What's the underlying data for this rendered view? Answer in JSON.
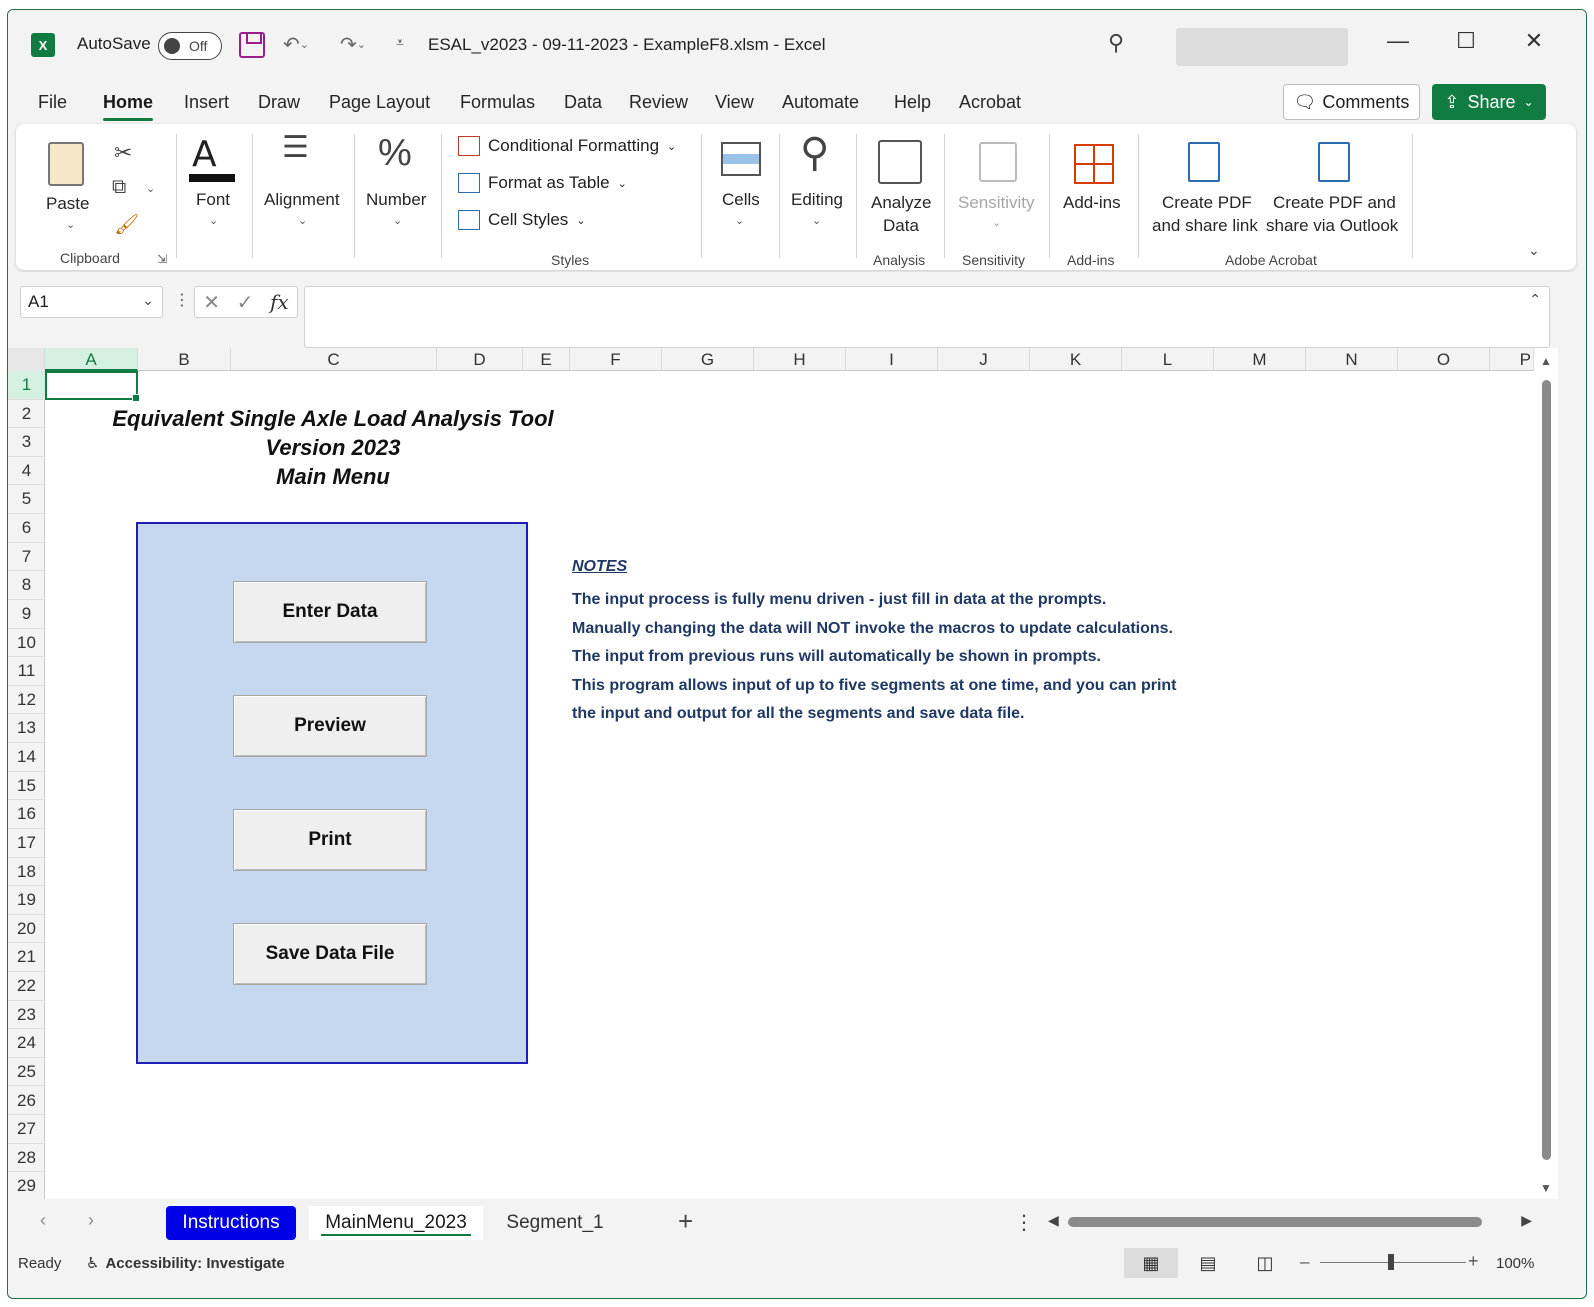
{
  "titlebar": {
    "app_icon": "excel-icon",
    "autosave_label": "AutoSave",
    "autosave_state": "Off",
    "document_title": "ESAL_v2023 - 09-11-2023 - ExampleF8.xlsm  -  Excel"
  },
  "menu": {
    "tabs": [
      "File",
      "Home",
      "Insert",
      "Draw",
      "Page Layout",
      "Formulas",
      "Data",
      "Review",
      "View",
      "Automate",
      "Help",
      "Acrobat"
    ],
    "active": "Home",
    "comments_label": "Comments",
    "share_label": "Share"
  },
  "ribbon": {
    "clipboard": {
      "paste": "Paste",
      "group": "Clipboard"
    },
    "font": "Font",
    "alignment": "Alignment",
    "number": "Number",
    "styles": {
      "conditional": "Conditional Formatting",
      "format_table": "Format as Table",
      "cell_styles": "Cell Styles",
      "group": "Styles"
    },
    "cells": "Cells",
    "editing": "Editing",
    "analyze": {
      "label1": "Analyze",
      "label2": "Data",
      "group": "Analysis"
    },
    "sensitivity": {
      "label": "Sensitivity",
      "group": "Sensitivity"
    },
    "addins": {
      "label": "Add-ins",
      "group": "Add-ins"
    },
    "acrobat": {
      "pdf_link_1": "Create PDF",
      "pdf_link_2": "and share link",
      "pdf_outlook_1": "Create PDF and",
      "pdf_outlook_2": "share via Outlook",
      "group": "Adobe Acrobat"
    }
  },
  "formula_bar": {
    "name_box": "A1",
    "fx": "fx",
    "formula": ""
  },
  "grid": {
    "columns": [
      "A",
      "B",
      "C",
      "D",
      "E",
      "F",
      "G",
      "H",
      "I",
      "J",
      "K",
      "L",
      "M",
      "N",
      "O",
      "P"
    ],
    "rows": [
      "1",
      "2",
      "3",
      "4",
      "5",
      "6",
      "7",
      "8",
      "9",
      "10",
      "11",
      "12",
      "13",
      "14",
      "15",
      "16",
      "17",
      "18",
      "19",
      "20",
      "21",
      "22",
      "23",
      "24",
      "25",
      "26",
      "27",
      "28",
      "29"
    ],
    "selected_cell": "A1"
  },
  "sheet": {
    "title_line1": "Equivalent Single Axle Load Analysis Tool",
    "title_line2": "Version 2023",
    "title_line3": "Main Menu",
    "buttons": {
      "enter_data": "Enter Data",
      "preview": "Preview",
      "print": "Print",
      "save_data_file": "Save Data File"
    },
    "notes": {
      "heading": "NOTES",
      "line1": "The input process is fully menu driven - just fill in data at the prompts.",
      "line2": "Manually changing the data will NOT invoke the macros to update calculations.",
      "line3": "The input from previous runs will automatically be shown in prompts.",
      "line4": "This program allows input of up to five segments at one time, and you can print",
      "line5": "the input and output for all the segments and save data file."
    }
  },
  "sheet_tabs": {
    "instructions": "Instructions",
    "main_menu": "MainMenu_2023",
    "segment": "Segment_1"
  },
  "status": {
    "ready": "Ready",
    "accessibility": "Accessibility: Investigate",
    "zoom": "100%"
  },
  "colors": {
    "accent": "#107c41",
    "panel": "#c5d8ef",
    "panel_border": "#1f1fb4",
    "instructions_tab": "#0000e6",
    "notes_text": "#1f3864"
  }
}
